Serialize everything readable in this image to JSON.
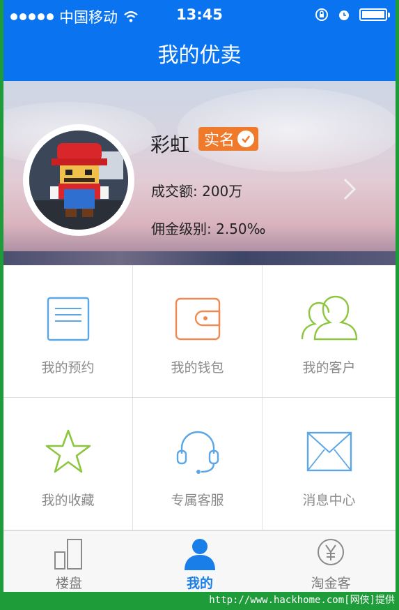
{
  "status_bar": {
    "carrier": "中国移动",
    "time": "13:45",
    "icons": [
      "signal-dots-icon",
      "wifi-icon",
      "orientation-lock-icon",
      "alarm-icon",
      "battery-icon"
    ]
  },
  "nav": {
    "title": "我的优卖"
  },
  "profile": {
    "name": "彩虹",
    "badge_label": "实名",
    "deal_amount_line": "成交额: 200万",
    "commission_line": "佣金级别: 2.50‰"
  },
  "grid": {
    "items": [
      {
        "label": "我的预约",
        "icon": "document-icon",
        "color": "#5aa6e6"
      },
      {
        "label": "我的钱包",
        "icon": "wallet-icon",
        "color": "#ef8a55"
      },
      {
        "label": "我的客户",
        "icon": "customers-icon",
        "color": "#8cc63f"
      },
      {
        "label": "我的收藏",
        "icon": "star-icon",
        "color": "#8cc63f"
      },
      {
        "label": "专属客服",
        "icon": "headset-icon",
        "color": "#5aa6e6"
      },
      {
        "label": "消息中心",
        "icon": "envelope-icon",
        "color": "#5aa6e6"
      }
    ]
  },
  "tabs": [
    {
      "label": "楼盘",
      "icon": "buildings-icon",
      "active": false
    },
    {
      "label": "我的",
      "icon": "person-icon",
      "active": true
    },
    {
      "label": "淘金客",
      "icon": "yen-coin-icon",
      "active": false
    }
  ],
  "colors": {
    "primary": "#0a73f0",
    "badge": "#f07a2c",
    "active_tab": "#1a7ee8"
  },
  "watermark": "http://www.hackhome.com[网侠]提供"
}
